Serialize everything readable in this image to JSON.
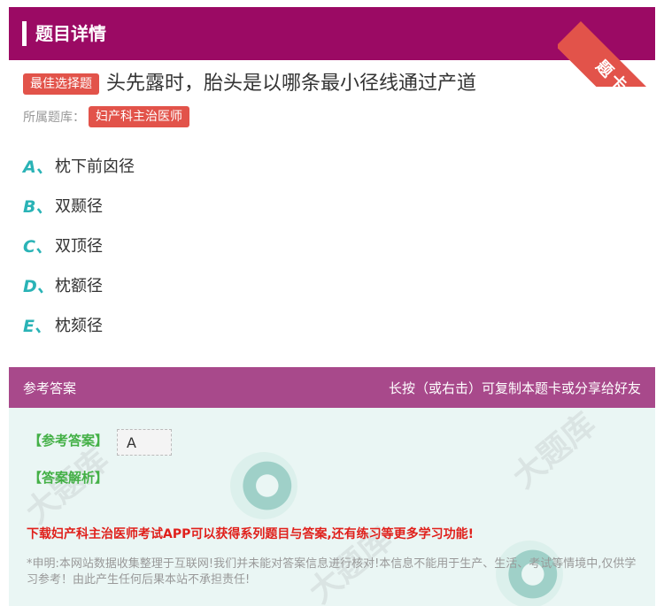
{
  "header": {
    "title": "题目详情",
    "ribbon": "题卡"
  },
  "question": {
    "badge": "最佳选择题",
    "text": "头先露时，胎头是以哪条最小径线通过产道",
    "bank_label": "所属题库：",
    "bank_tag": "妇产科主治医师"
  },
  "options": [
    {
      "letter": "A、",
      "text": "枕下前囟径"
    },
    {
      "letter": "B、",
      "text": "双颞径"
    },
    {
      "letter": "C、",
      "text": "双顶径"
    },
    {
      "letter": "D、",
      "text": "枕额径"
    },
    {
      "letter": "E、",
      "text": "枕颏径"
    }
  ],
  "answer": {
    "header_left": "参考答案",
    "header_right": "长按（或右击）可复制本题卡或分享给好友",
    "answer_label": "【参考答案】",
    "answer_value": "A",
    "analysis_label": "【答案解析】",
    "download": "下载妇产科主治医师考试APP可以获得系列题目与答案,还有练习等更多学习功能!",
    "disclaimer": "*申明:本网站数据收集整理于互联网!我们并未能对答案信息进行核对!本信息不能用于生产、生活、考试等情境中,仅供学习参考！由此产生任何后果本站不承担责任!"
  },
  "colors": {
    "header_bg": "#9b0a64",
    "accent_red": "#e2534a",
    "option_letter": "#2ab3b6",
    "answer_header_bg": "#a8498b",
    "answer_body_bg": "#eaf6f4",
    "answer_green": "#43b046",
    "download_red": "#e0201b"
  }
}
